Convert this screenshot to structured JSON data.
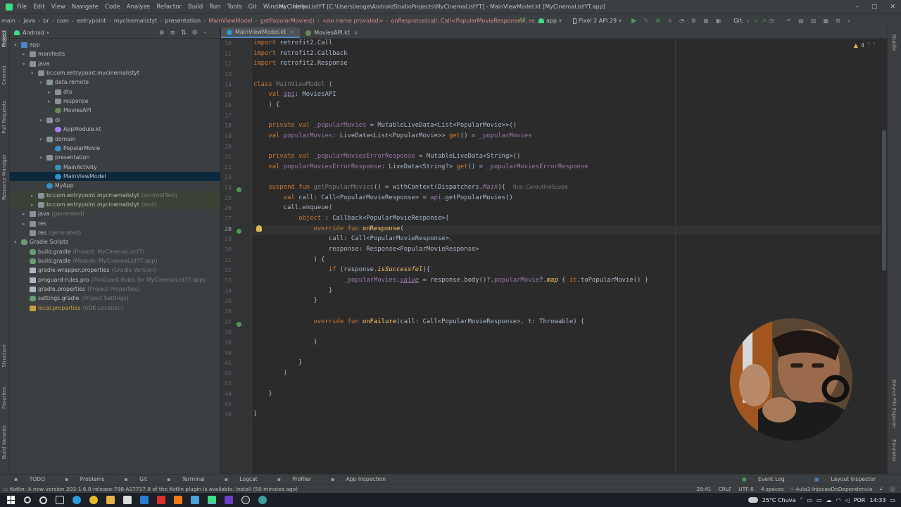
{
  "menu": [
    "File",
    "Edit",
    "View",
    "Navigate",
    "Code",
    "Analyze",
    "Refactor",
    "Build",
    "Run",
    "Tools",
    "Git",
    "Window",
    "Help"
  ],
  "window_title": "MyCinemaListYT [C:\\Users\\leoge\\AndroidStudioProjects\\MyCinemaListYT] - MainViewModel.kt [MyCinemaListYT.app]",
  "breadcrumb": [
    "main",
    "java",
    "br",
    "com",
    "entrypoint",
    "mycinemalistyt",
    "presentation",
    "MainViewModel",
    "getPopularMovies()",
    "<no name provided>",
    "onResponse(call: Call<PopularMovieResponse>, re..."
  ],
  "toolbar": {
    "run_config": "app",
    "device": "Pixel 2 API 29",
    "git_label": "Git:"
  },
  "project_panel": {
    "view_label": "Android",
    "tree": [
      {
        "label": "app",
        "hint": "",
        "depth": 0,
        "arrow": "▾",
        "icon": "folder",
        "color": "#4a88c7"
      },
      {
        "label": "manifests",
        "hint": "",
        "depth": 1,
        "arrow": "▸",
        "icon": "folder",
        "color": "#87939a"
      },
      {
        "label": "java",
        "hint": "",
        "depth": 1,
        "arrow": "▾",
        "icon": "folder",
        "color": "#87939a"
      },
      {
        "label": "br.com.entrypoint.mycinemalistyt",
        "hint": "",
        "depth": 2,
        "arrow": "▾",
        "icon": "package",
        "color": "#87939a"
      },
      {
        "label": "data.remote",
        "hint": "",
        "depth": 3,
        "arrow": "▾",
        "icon": "package",
        "color": "#87939a"
      },
      {
        "label": "dto",
        "hint": "",
        "depth": 4,
        "arrow": "▸",
        "icon": "package",
        "color": "#87939a"
      },
      {
        "label": "response",
        "hint": "",
        "depth": 4,
        "arrow": "▸",
        "icon": "package",
        "color": "#87939a"
      },
      {
        "label": "MoviesAPI",
        "hint": "",
        "depth": 4,
        "arrow": "",
        "icon": "kotlin",
        "color": "#6a8759"
      },
      {
        "label": "di",
        "hint": "",
        "depth": 3,
        "arrow": "▾",
        "icon": "package",
        "color": "#87939a"
      },
      {
        "label": "AppModule.kt",
        "hint": "",
        "depth": 4,
        "arrow": "",
        "icon": "kotlin",
        "color": "#a97bff"
      },
      {
        "label": "domain",
        "hint": "",
        "depth": 3,
        "arrow": "▾",
        "icon": "package",
        "color": "#87939a"
      },
      {
        "label": "PopularMovie",
        "hint": "",
        "depth": 4,
        "arrow": "",
        "icon": "kotlin",
        "color": "#3592c4"
      },
      {
        "label": "presentation",
        "hint": "",
        "depth": 3,
        "arrow": "▾",
        "icon": "package",
        "color": "#87939a"
      },
      {
        "label": "MainActivity",
        "hint": "",
        "depth": 4,
        "arrow": "",
        "icon": "kotlin",
        "color": "#3592c4"
      },
      {
        "label": "MainViewModel",
        "hint": "",
        "depth": 4,
        "arrow": "",
        "icon": "kotlin",
        "color": "#3592c4",
        "selected": true
      },
      {
        "label": "MyApp",
        "hint": "",
        "depth": 3,
        "arrow": "",
        "icon": "kotlin",
        "color": "#3592c4"
      },
      {
        "label": "br.com.entrypoint.mycinemalistyt",
        "hint": "(androidTest)",
        "depth": 2,
        "arrow": "▸",
        "icon": "package",
        "color": "#87939a",
        "test": true
      },
      {
        "label": "br.com.entrypoint.mycinemalistyt",
        "hint": "(test)",
        "depth": 2,
        "arrow": "▸",
        "icon": "package",
        "color": "#87939a",
        "test": true
      },
      {
        "label": "java",
        "hint": "(generated)",
        "depth": 1,
        "arrow": "▸",
        "icon": "folder",
        "color": "#87939a"
      },
      {
        "label": "res",
        "hint": "",
        "depth": 1,
        "arrow": "▸",
        "icon": "folder",
        "color": "#87939a"
      },
      {
        "label": "res",
        "hint": "(generated)",
        "depth": 1,
        "arrow": "",
        "icon": "folder",
        "color": "#87939a"
      },
      {
        "label": "Gradle Scripts",
        "hint": "",
        "depth": 0,
        "arrow": "▾",
        "icon": "gradle",
        "color": "#6a9a74"
      },
      {
        "label": "build.gradle",
        "hint": "(Project: MyCinemaListYT)",
        "depth": 1,
        "arrow": "",
        "icon": "gradle",
        "color": "#6a9a74"
      },
      {
        "label": "build.gradle",
        "hint": "(Module: MyCinemaListYT.app)",
        "depth": 1,
        "arrow": "",
        "icon": "gradle",
        "color": "#6a9a74"
      },
      {
        "label": "gradle-wrapper.properties",
        "hint": "(Gradle Version)",
        "depth": 1,
        "arrow": "",
        "icon": "props",
        "color": "#a9b7c6"
      },
      {
        "label": "proguard-rules.pro",
        "hint": "(ProGuard Rules for MyCinemaListYT.app)",
        "depth": 1,
        "arrow": "",
        "icon": "props",
        "color": "#a9b7c6"
      },
      {
        "label": "gradle.properties",
        "hint": "(Project Properties)",
        "depth": 1,
        "arrow": "",
        "icon": "props",
        "color": "#a9b7c6"
      },
      {
        "label": "settings.gradle",
        "hint": "(Project Settings)",
        "depth": 1,
        "arrow": "",
        "icon": "gradle",
        "color": "#6a9a74"
      },
      {
        "label": "local.properties",
        "hint": "(SDK Location)",
        "depth": 1,
        "arrow": "",
        "icon": "props",
        "color": "#c5a03b",
        "warn": true
      }
    ]
  },
  "tabs": [
    {
      "label": "MainViewModel.kt",
      "active": true
    },
    {
      "label": "MoviesAPI.kt",
      "active": false
    }
  ],
  "inspection": {
    "warnings": "4"
  },
  "code_lines": [
    {
      "n": "10",
      "html": "<span class='k'>import</span> retrofit2.Call"
    },
    {
      "n": "11",
      "html": "<span class='k'>import</span> retrofit2.Callback"
    },
    {
      "n": "12",
      "html": "<span class='k'>import</span> retrofit2.Response"
    },
    {
      "n": "13",
      "html": ""
    },
    {
      "n": "14",
      "html": "<span class='k'>class</span> <span class='g'>MainViewModel</span> ("
    },
    {
      "n": "15",
      "html": "    <span class='k'>val</span> <span class='p u'>api</span>: MoviesAPI"
    },
    {
      "n": "16",
      "html": "    ) {"
    },
    {
      "n": "17",
      "html": ""
    },
    {
      "n": "18",
      "html": "    <span class='k'>private val</span> <span class='p'>_popularMovies</span> = MutableLiveData&lt;List&lt;PopularMovie&gt;&gt;()"
    },
    {
      "n": "19",
      "html": "    <span class='k'>val</span> <span class='p'>popularMovies</span>: LiveData&lt;List&lt;PopularMovie&gt;&gt; <span class='k'>get</span>() = <span class='p'>_popularMovies</span>"
    },
    {
      "n": "20",
      "html": ""
    },
    {
      "n": "21",
      "html": "    <span class='k'>private val</span> <span class='p'>_popularMoviesErrorResponse</span> = MutableLiveData&lt;String&gt;()"
    },
    {
      "n": "22",
      "html": "    <span class='k'>val</span> <span class='p'>popularMoviesErrorResponse</span>: LiveData&lt;String?&gt; <span class='k'>get</span>() = <span class='p'>_popularMoviesErrorResponse</span>"
    },
    {
      "n": "23",
      "html": ""
    },
    {
      "n": "24",
      "html": "    <span class='k'>suspend fun</span> <span class='g'>getPopularMovies</span>() = withContext(Dispatchers.<span class='it'>Main</span>){  <span class='g' style='font-family:\"DejaVu Sans\",sans-serif;font-size:7.5px'>this: CoroutineScope</span>"
    },
    {
      "n": "25",
      "html": "        <span class='k'>val</span> call: Call&lt;PopularMovieResponse&gt; = <span class='p'>api</span>.getPopularMovies()"
    },
    {
      "n": "26",
      "html": "        call.enqueue("
    },
    {
      "n": "27",
      "html": "            <span class='k'>object</span> : Callback&lt;PopularMovieResponse&gt;{"
    },
    {
      "n": "28",
      "html": "                <span class='k'>override fun</span> <span class='f'>onResponse</span>(",
      "cur": true
    },
    {
      "n": "29",
      "html": "                    call: Call&lt;PopularMovieResponse&gt;<span class='k'>,</span>"
    },
    {
      "n": "30",
      "html": "                    response: Response&lt;PopularMovieResponse&gt;"
    },
    {
      "n": "31",
      "html": "                ) {"
    },
    {
      "n": "32",
      "html": "                    <span class='k'>if</span> (response.<span class='fi'>isSuccessful</span>){"
    },
    {
      "n": "33",
      "html": "                        <span class='p'>_popularMovies</span>.<span class='it u'>value</span> = response.body()?.<span class='p'>popularMovie</span>?.<span class='fi'>map</span> { <span class='k'>it</span>.toPopularMovie() }"
    },
    {
      "n": "34",
      "html": "                    }"
    },
    {
      "n": "35",
      "html": "                }"
    },
    {
      "n": "36",
      "html": ""
    },
    {
      "n": "37",
      "html": "                <span class='k'>override fun</span> <span class='f'>onFailure</span>(call: Call&lt;PopularMovieResponse&gt;<span class='k'>,</span> t: Throwable) {"
    },
    {
      "n": "38",
      "html": ""
    },
    {
      "n": "39",
      "html": "                }"
    },
    {
      "n": "40",
      "html": ""
    },
    {
      "n": "41",
      "html": "            }"
    },
    {
      "n": "42",
      "html": "        )"
    },
    {
      "n": "43",
      "html": ""
    },
    {
      "n": "44",
      "html": "    }"
    },
    {
      "n": "45",
      "html": ""
    },
    {
      "n": "46",
      "html": "}"
    }
  ],
  "bottom_tools": [
    "TODO",
    "Problems",
    "Git",
    "Terminal",
    "Logcat",
    "Profiler",
    "App Inspection"
  ],
  "bottom_right_tools": [
    "Event Log",
    "Layout Inspector"
  ],
  "status": {
    "message": "Kotlin: A new version 203-1.6.0-release-798-AS7717.8 of the Kotlin plugin is available. Install (50 minutes ago)",
    "position": "28:41",
    "line_sep": "CRLF",
    "encoding": "UTF-8",
    "indent": "4 spaces",
    "branch": "Aula3-InjecaoDeDependencia"
  },
  "left_strip_labels": [
    "Project",
    "Commit",
    "Pull Requests",
    "Resource Manager",
    "Structure",
    "Favorites",
    "Build Variants"
  ],
  "right_strip_labels": [
    "Gradle",
    "Device File Explorer",
    "Emulator"
  ],
  "taskbar": {
    "weather": "25°C Chuva",
    "lang": "POR",
    "time": "14:33"
  },
  "colors": {
    "accent": "#4a88c7",
    "keyword": "#cc7832",
    "function": "#ffc66d",
    "property": "#9876aa",
    "text": "#a9b7c6"
  }
}
